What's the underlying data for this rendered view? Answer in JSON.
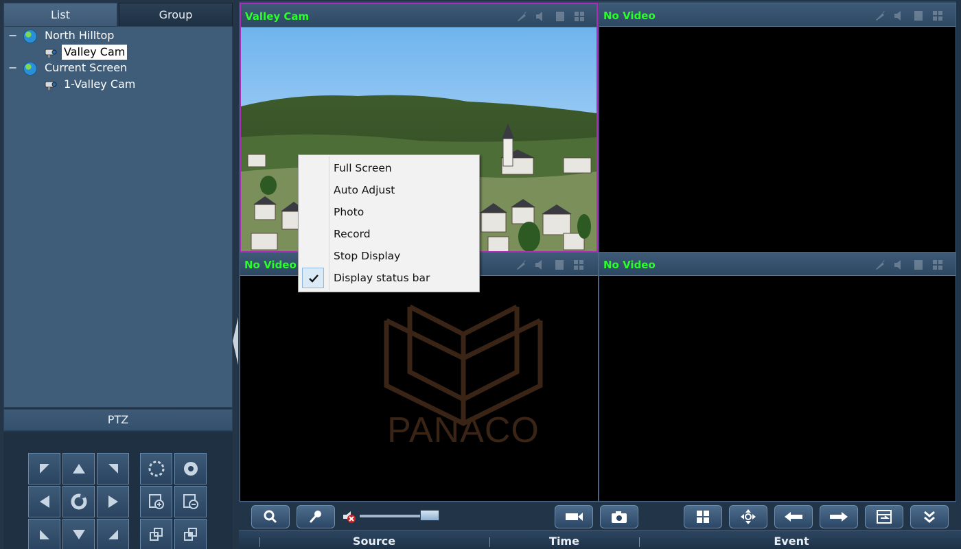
{
  "left_panel": {
    "tabs": [
      {
        "label": "List",
        "active": true
      },
      {
        "label": "Group",
        "active": false
      }
    ],
    "tree": [
      {
        "label": "North Hilltop",
        "toggle": "−",
        "icon": "globe-icon",
        "level": 0
      },
      {
        "label": "Valley Cam",
        "icon": "camera-icon",
        "level": 1,
        "selected": true
      },
      {
        "label": "Current Screen",
        "toggle": "−",
        "icon": "globe-icon",
        "level": 0
      },
      {
        "label": "1-Valley Cam",
        "icon": "camera-icon",
        "level": 1
      }
    ],
    "ptz_label": "PTZ",
    "ptz_buttons": [
      "pan-up-left",
      "pan-up",
      "pan-up-right",
      "iris-close",
      "iris-open",
      "pan-left",
      "ptz-auto",
      "pan-right",
      "focus-near",
      "focus-far",
      "pan-down-left",
      "pan-down",
      "pan-down-right",
      "zoom-out",
      "zoom-in"
    ]
  },
  "video": {
    "cells": [
      {
        "title": "Valley Cam",
        "active": true,
        "has_image": true
      },
      {
        "title": "No Video",
        "active": false
      },
      {
        "title": "No Video",
        "active": false
      },
      {
        "title": "No Video",
        "active": false
      }
    ],
    "watermark_text": "PANACO",
    "title_color": "#2aff2a",
    "active_border_color": "#b02cb8"
  },
  "context_menu": {
    "items": [
      {
        "label": "Full Screen",
        "checked": false
      },
      {
        "label": "Auto Adjust",
        "checked": false
      },
      {
        "label": "Photo",
        "checked": false
      },
      {
        "label": "Record",
        "checked": false
      },
      {
        "label": "Stop Display",
        "checked": false
      },
      {
        "label": "Display status bar",
        "checked": true
      }
    ]
  },
  "toolbar": {
    "buttons": [
      "zoom-icon",
      "microphone-icon",
      "speaker-muted-icon",
      "record-icon",
      "snapshot-icon",
      "layout-grid-icon",
      "ptz-direction-icon",
      "previous-icon",
      "next-icon",
      "switch-screen-icon",
      "expand-down-icon"
    ],
    "volume_level": 0.95
  },
  "events": {
    "columns": [
      "Source",
      "Time",
      "Event"
    ]
  }
}
